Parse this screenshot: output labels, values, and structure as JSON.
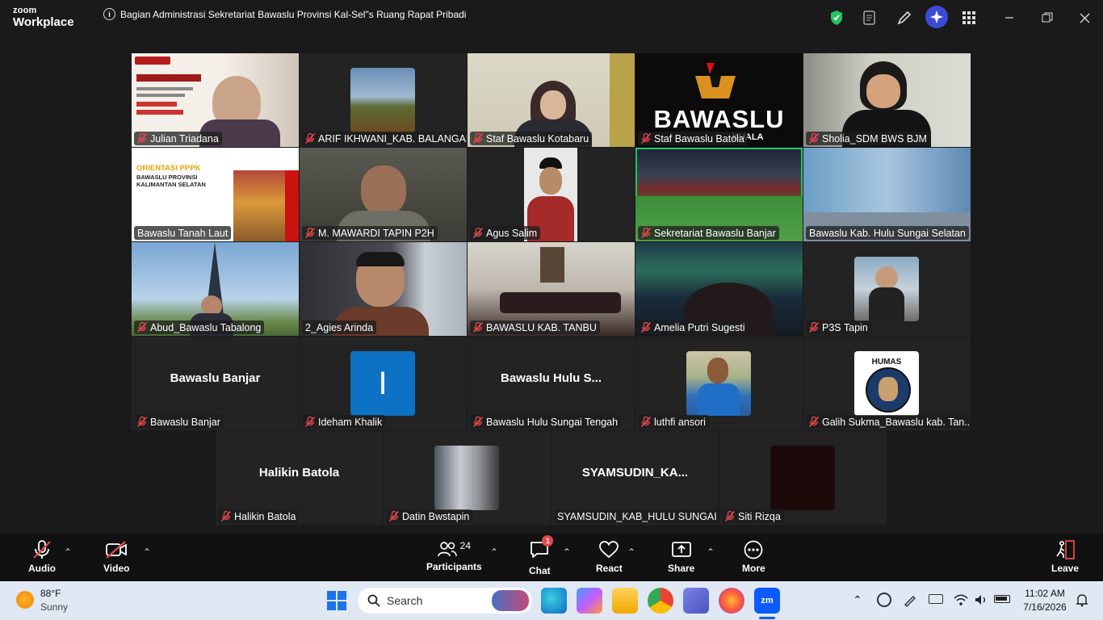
{
  "app": {
    "brand_top": "zoom",
    "brand_bottom": "Workplace"
  },
  "meeting": {
    "title": "Bagian Administrasi Sekretariat Bawaslu Provinsi Kal-Sel\"s Ruang Rapat Pribadi"
  },
  "tiles": [
    {
      "name": "Julian Triadana"
    },
    {
      "name": "ARIF IKHWANI_KAB. BALANGAN"
    },
    {
      "name": "Staf Bawaslu Kotabaru"
    },
    {
      "name": "Staf Bawaslu Batola",
      "logo_text": "BAWASLU",
      "logo_sub": "KUALA"
    },
    {
      "name": "Sholia_SDM BWS BJM"
    },
    {
      "name": "Bawaslu Tanah Laut",
      "slide_title": "ORIENTASI PPPK",
      "slide_sub": "BAWASLU PROVINSI KALIMANTAN SELATAN"
    },
    {
      "name": "M. MAWARDI  TAPIN P2H"
    },
    {
      "name": "Agus Salim"
    },
    {
      "name": "Sekretariat Bawaslu Banjar"
    },
    {
      "name": "Bawaslu Kab. Hulu Sungai Selatan"
    },
    {
      "name": "Abud_Bawaslu Tabalong"
    },
    {
      "name": "2_Agies Arinda"
    },
    {
      "name": "BAWASLU KAB. TANBU"
    },
    {
      "name": "Amelia Putri Sugesti"
    },
    {
      "name": "P3S Tapin"
    },
    {
      "name": "Bawaslu Banjar",
      "big": "Bawaslu Banjar"
    },
    {
      "name": "Ideham Khalik",
      "initial": "I"
    },
    {
      "name": "Bawaslu Hulu Sungai Tengah",
      "big": "Bawaslu  Hulu  S..."
    },
    {
      "name": "luthfi ansori"
    },
    {
      "name": "Galih Sukma_Bawaslu kab. Tan...",
      "badge": "HUMAS"
    },
    {
      "name": "Halikin Batola",
      "big": "Halikin Batola"
    },
    {
      "name": "Datin Bwstapin"
    },
    {
      "name": "SYAMSUDIN_KAB_HULU SUNGAI ...",
      "big": "SYAMSUDIN_KA..."
    },
    {
      "name": "Siti Rizqa"
    }
  ],
  "toolbar": {
    "audio": "Audio",
    "video": "Video",
    "participants": "Participants",
    "participants_count": "24",
    "chat": "Chat",
    "chat_badge": "1",
    "react": "React",
    "share": "Share",
    "more": "More",
    "leave": "Leave"
  },
  "taskbar": {
    "weather_temp": "88°F",
    "weather_desc": "Sunny",
    "search_placeholder": "Search",
    "time": "11:02 AM",
    "date": "7/16/2026"
  },
  "colors": {
    "active_border": "#22c55e",
    "mute_red": "#e5484d",
    "accent_blue": "#0b5cff"
  }
}
